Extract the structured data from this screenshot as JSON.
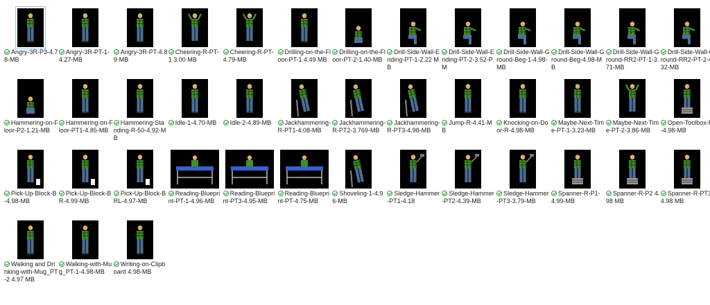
{
  "files": [
    {
      "name": "Angry-3R-P3-4.78-MB",
      "pose": "stand",
      "selected": true
    },
    {
      "name": "Angry-3R-PT-1-4.27-MB",
      "pose": "stand"
    },
    {
      "name": "Angry-3R-PT-4.89-MB",
      "pose": "stand"
    },
    {
      "name": "Cheering-R-PT-1 3.00 MB",
      "pose": "cheer"
    },
    {
      "name": "Cheering-R-PT-4.79-MB",
      "pose": "cheer"
    },
    {
      "name": "Drilling-on-the-Floor-PT-1 4.49 MB",
      "pose": "stand"
    },
    {
      "name": "Drilling-on-the-Floor-PT-2-1.40-MB",
      "pose": "crouch"
    },
    {
      "name": "Drill-Side-Wall-Ending-PT-1-2.22 MB",
      "pose": "kneel"
    },
    {
      "name": "Drill-Side-Wall-Ending-PT-2-3.52-PM",
      "pose": "kneel"
    },
    {
      "name": "Drill-Side-Wall-Ground-Beg-1-4.98-MB",
      "pose": "kneel"
    },
    {
      "name": "Drill-Side-Wall-Ground-Beg-4.98-MB",
      "pose": "kneel"
    },
    {
      "name": "Drill-Side-Wall-Ground-RR2-PT-1-3.71-MB",
      "pose": "kneel"
    },
    {
      "name": "Drill-Side-Wall-Ground-RR2-PT-2-4.32-MB",
      "pose": "kneel"
    },
    {
      "name": "Hammering-on-Floor-P2-1.21-MB",
      "pose": "crouch"
    },
    {
      "name": "Hammering-on-Floor-PT1-4.85-MB",
      "pose": "stand"
    },
    {
      "name": "Hammering-Standing-R-50-4.92-MB",
      "pose": "stand"
    },
    {
      "name": "Idle-1-4.70-MB",
      "pose": "stand"
    },
    {
      "name": "Idle-2-4.89-MB",
      "pose": "stand"
    },
    {
      "name": "Jackhammering-R-PT1-4.08-MB",
      "pose": "bend"
    },
    {
      "name": "Jackhammering-R-PT2-3.769-MB",
      "pose": "bend"
    },
    {
      "name": "Jackhammering-R-PT3-4.98-MB",
      "pose": "bend"
    },
    {
      "name": "Jump-R-4.41-MB",
      "pose": "stand"
    },
    {
      "name": "Knocking-on-Door-R-4.98-MB",
      "pose": "stand"
    },
    {
      "name": "Maybe-Next-Time-PT-1-3.23-MB",
      "pose": "stand"
    },
    {
      "name": "Maybe-Next-Time-PT-2-3.86-MB",
      "pose": "cheer"
    },
    {
      "name": "Open-Toolbox-R-4.98-MB",
      "pose": "toolbox"
    },
    {
      "name": "Pick-Up-Block-B-4.98-MB",
      "pose": "block"
    },
    {
      "name": "Pick-Up-Block-BR-4.99-MB",
      "pose": "block"
    },
    {
      "name": "Pick-Up-Block-BRL-4.97-MB",
      "pose": "block"
    },
    {
      "name": "Reading-Blueprint-PT-1-4.96-MB",
      "pose": "table"
    },
    {
      "name": "Reading-Blueprint-PT3-4.95-MB",
      "pose": "table"
    },
    {
      "name": "Reading-Blueprint-PT-4.75-MB",
      "pose": "table"
    },
    {
      "name": "Shoveling-1-4.96-MB",
      "pose": "bend"
    },
    {
      "name": "Sledge-Hammer-PT1-4.18",
      "pose": "sledge"
    },
    {
      "name": "Sledge-Hammer-PT2-4.39-MB",
      "pose": "sledge"
    },
    {
      "name": "Sledge-Hammer-PT3-3.79-MB",
      "pose": "sledge"
    },
    {
      "name": "Spanner-R-P1-4.99-MB",
      "pose": "toolbox"
    },
    {
      "name": "Spanner-R-P2 4.98 MB",
      "pose": "toolbox"
    },
    {
      "name": "Spanner-R-PT3 4.98 MB",
      "pose": "toolbox"
    },
    {
      "name": "Walking and Drinking-with-Mug_PT-2 4.97 MB",
      "pose": "stand"
    },
    {
      "name": "Walking-with-Mug_PT-1-4.98-MB",
      "pose": "stand"
    },
    {
      "name": "Writing-on-Clipboard 4.98-MB",
      "pose": "stand"
    }
  ],
  "colors": {
    "thumb_bg": "#000000",
    "shirt_green": "#3f8f2a",
    "shirt_dark": "#1f3f12",
    "jeans": "#4d6f96",
    "helmet": "#e0c23a",
    "skin": "#d9a77a",
    "table_blue": "#3a5fd0",
    "sync_green": "#2f9e44"
  }
}
